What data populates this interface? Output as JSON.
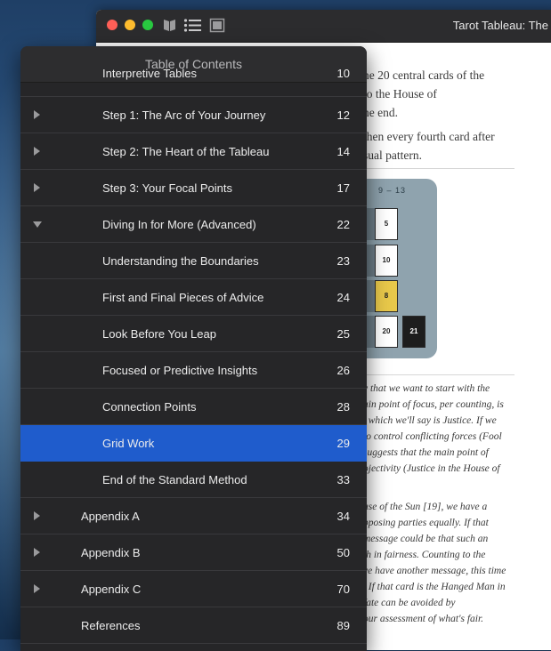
{
  "window": {
    "title": "Tarot Tableau: The",
    "tooltbar_icons": [
      "library-icon",
      "toc-list-icon",
      "view-mode-icon"
    ]
  },
  "book": {
    "lines": [
      "he 20 central cards of the",
      "to the House of",
      "he end.",
      "then every fourth card after",
      "sual pattern."
    ],
    "grid_label": "9 – 13",
    "cards": [
      "5",
      "10",
      "8",
      "20",
      "21"
    ],
    "italic_lines": [
      "y that we want to start with the",
      "ain point of focus, per counting, is",
      ", which we'll say is Justice. If we",
      "to control conflicting forces (Fool",
      "suggests that the main point of",
      "ojectivity (Justice in the House of",
      "use of the Sun [19], we have a",
      "pposing parties equally. If that",
      "message could be that such an",
      "th in fairness. Counting to the",
      "ve have another message, this time",
      ". If that card is the Hanged Man in",
      "fate can be avoided by",
      "our assessment of what's fair."
    ]
  },
  "toc": {
    "title": "Table of Contents",
    "items": [
      {
        "label": "Interpretive Tables",
        "page": "10",
        "level": 2,
        "disclosure": "none"
      },
      {
        "label": "Step 1: The Arc of Your Journey",
        "page": "12",
        "level": 2,
        "disclosure": "collapsed"
      },
      {
        "label": "Step 2: The Heart of the Tableau",
        "page": "14",
        "level": 2,
        "disclosure": "collapsed"
      },
      {
        "label": "Step 3: Your Focal Points",
        "page": "17",
        "level": 2,
        "disclosure": "collapsed"
      },
      {
        "label": "Diving In for More (Advanced)",
        "page": "22",
        "level": 2,
        "disclosure": "expanded"
      },
      {
        "label": "Understanding the Boundaries",
        "page": "23",
        "level": 2,
        "disclosure": "none"
      },
      {
        "label": "First and Final Pieces of Advice",
        "page": "24",
        "level": 2,
        "disclosure": "none"
      },
      {
        "label": "Look Before You Leap",
        "page": "25",
        "level": 2,
        "disclosure": "none"
      },
      {
        "label": "Focused or Predictive Insights",
        "page": "26",
        "level": 2,
        "disclosure": "none"
      },
      {
        "label": "Connection Points",
        "page": "28",
        "level": 2,
        "disclosure": "none"
      },
      {
        "label": "Grid Work",
        "page": "29",
        "level": 2,
        "disclosure": "none",
        "selected": true
      },
      {
        "label": "End of the Standard Method",
        "page": "33",
        "level": 2,
        "disclosure": "none"
      },
      {
        "label": "Appendix A",
        "page": "34",
        "level": 1,
        "disclosure": "collapsed"
      },
      {
        "label": "Appendix B",
        "page": "50",
        "level": 1,
        "disclosure": "collapsed"
      },
      {
        "label": "Appendix C",
        "page": "70",
        "level": 1,
        "disclosure": "collapsed"
      },
      {
        "label": "References",
        "page": "89",
        "level": 1,
        "disclosure": "none"
      }
    ]
  },
  "colors": {
    "selection": "#1f5ccc",
    "popover_bg": "#262628",
    "titlebar_bg": "#2c2c2e"
  }
}
